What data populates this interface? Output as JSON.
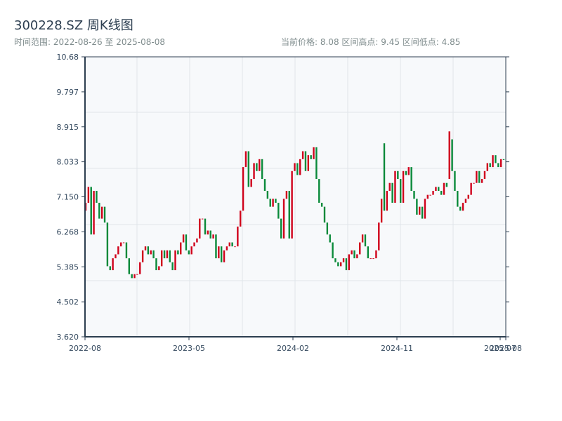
{
  "header": {
    "title": "300228.SZ 周K线图",
    "range_text": "时间范围: 2022-08-26 至 2025-08-08",
    "stats_text": "当前价格: 8.08  区间高点: 9.45  区间低点: 4.85"
  },
  "colors": {
    "up": "#d0021b",
    "down": "#0a8a3a",
    "plot_bg": "#f7f9fb",
    "grid": "#e1e5ea",
    "axis": "#2c3e50"
  },
  "chart_data": {
    "type": "candlestick",
    "title": "300228.SZ 周K线图",
    "period": "weekly",
    "x_range": [
      "2022-08-26",
      "2025-08-08"
    ],
    "ylim": [
      3.62,
      10.68
    ],
    "y_ticks": [
      "3.620",
      "4.502",
      "5.385",
      "6.268",
      "7.150",
      "8.033",
      "8.915",
      "9.797",
      "10.68"
    ],
    "x_ticks": [
      "2022-08",
      "2023-05",
      "2024-02",
      "2024-11",
      "2025-07",
      "2025-08"
    ],
    "current_price": 8.08,
    "period_high": 9.45,
    "period_low": 4.85,
    "grid": true,
    "open": [
      6.8,
      7.0,
      7.4,
      6.2,
      7.3,
      7.0,
      6.6,
      6.9,
      6.5,
      5.4,
      5.3,
      5.6,
      5.7,
      5.9,
      6.0,
      6.0,
      5.6,
      5.2,
      5.1,
      5.2,
      5.2,
      5.5,
      5.8,
      5.9,
      5.7,
      5.8,
      5.6,
      5.3,
      5.4,
      5.8,
      5.6,
      5.8,
      5.5,
      5.3,
      5.8,
      5.7,
      6.0,
      6.2,
      5.8,
      5.7,
      5.9,
      6.0,
      6.1,
      6.6,
      6.6,
      6.2,
      6.3,
      6.1,
      6.2,
      5.6,
      5.9,
      5.5,
      5.8,
      5.9,
      6.0,
      5.9,
      5.9,
      6.4,
      6.8,
      7.9,
      8.3,
      7.4,
      7.6,
      8.0,
      7.8,
      8.1,
      7.6,
      7.3,
      7.1,
      6.9,
      7.1,
      7.0,
      6.6,
      6.1,
      7.1,
      7.3,
      6.1,
      7.8,
      8.0,
      7.7,
      8.1,
      8.3,
      7.8,
      8.2,
      8.1,
      8.4,
      7.6,
      7.0,
      6.9,
      6.5,
      6.2,
      6.0,
      5.6,
      5.5,
      5.4,
      5.5,
      5.6,
      5.3,
      5.7,
      5.8,
      5.6,
      5.7,
      6.0,
      6.2,
      5.9,
      5.6,
      5.6,
      5.6,
      5.8,
      6.5,
      8.5,
      6.8,
      7.3,
      7.5,
      7.0,
      7.8,
      7.6,
      7.0,
      7.8,
      7.7,
      7.9,
      7.3,
      7.1,
      6.7,
      6.9,
      6.6,
      7.1,
      7.2,
      7.2,
      7.3,
      7.4,
      7.3,
      7.2,
      7.5,
      7.6,
      8.6,
      7.8,
      7.3,
      6.9,
      6.8,
      7.0,
      7.1,
      7.2,
      7.5,
      7.5,
      7.8,
      7.5,
      7.6,
      7.8,
      8.0,
      7.9,
      8.2,
      8.0,
      7.9,
      8.1
    ],
    "close": [
      7.0,
      7.4,
      6.2,
      7.3,
      7.0,
      6.6,
      6.9,
      6.5,
      5.4,
      5.3,
      5.6,
      5.7,
      5.9,
      6.0,
      6.0,
      5.6,
      5.2,
      5.1,
      5.2,
      5.2,
      5.5,
      5.8,
      5.9,
      5.7,
      5.8,
      5.6,
      5.3,
      5.4,
      5.8,
      5.6,
      5.8,
      5.5,
      5.3,
      5.8,
      5.7,
      6.0,
      6.2,
      5.8,
      5.7,
      5.9,
      6.0,
      6.1,
      6.6,
      6.6,
      6.2,
      6.3,
      6.1,
      6.2,
      5.6,
      5.9,
      5.5,
      5.8,
      5.9,
      6.0,
      5.9,
      5.9,
      6.4,
      6.8,
      7.9,
      8.3,
      7.4,
      7.6,
      8.0,
      7.8,
      8.1,
      7.6,
      7.3,
      7.1,
      6.9,
      7.1,
      7.0,
      6.6,
      6.1,
      7.1,
      7.3,
      6.1,
      7.8,
      8.0,
      7.7,
      8.1,
      8.3,
      7.8,
      8.2,
      8.1,
      8.4,
      7.6,
      7.0,
      6.9,
      6.5,
      6.2,
      6.0,
      5.6,
      5.5,
      5.4,
      5.5,
      5.6,
      5.3,
      5.7,
      5.8,
      5.6,
      5.7,
      6.0,
      6.2,
      5.9,
      5.6,
      5.6,
      5.6,
      5.8,
      6.5,
      7.1,
      6.8,
      7.3,
      7.5,
      7.0,
      7.8,
      7.6,
      7.0,
      7.8,
      7.7,
      7.9,
      7.3,
      7.1,
      6.7,
      6.9,
      6.6,
      7.1,
      7.2,
      7.2,
      7.3,
      7.4,
      7.3,
      7.2,
      7.5,
      7.4,
      8.8,
      7.8,
      7.3,
      6.9,
      6.8,
      7.0,
      7.1,
      7.2,
      7.5,
      7.5,
      7.8,
      7.5,
      7.6,
      7.8,
      8.0,
      7.9,
      8.2,
      8.0,
      7.9,
      8.1,
      8.08
    ]
  }
}
